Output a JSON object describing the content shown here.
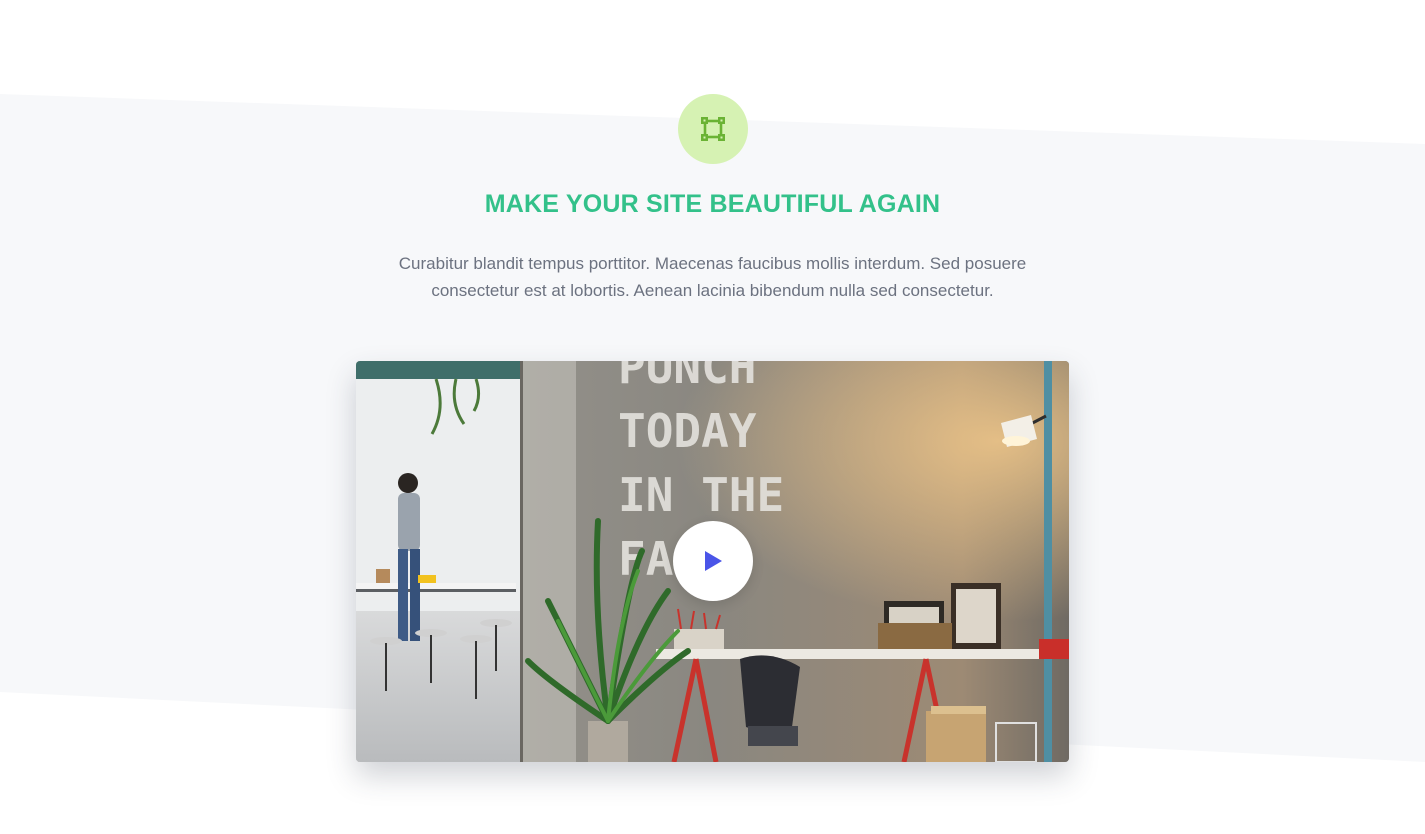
{
  "feature": {
    "icon": "crop-frame-icon",
    "title": "MAKE YOUR SITE BEAUTIFUL AGAIN",
    "description": "Curabitur blandit tempus porttitor. Maecenas faucibus mollis interdum. Sed posuere consectetur est at lobortis. Aenean lacinia bibendum nulla sed consectetur."
  },
  "video": {
    "play_icon": "play-icon",
    "wall_text": [
      "PUNCH",
      "TODAY",
      "IN THE",
      "FACE."
    ]
  },
  "colors": {
    "accent_green": "#33c18a",
    "icon_bg": "#d6f2b3",
    "icon_fg": "#6ab334",
    "play_blue": "#4a55e8",
    "band_bg": "#f7f8fa",
    "body_text": "#6c7280"
  }
}
